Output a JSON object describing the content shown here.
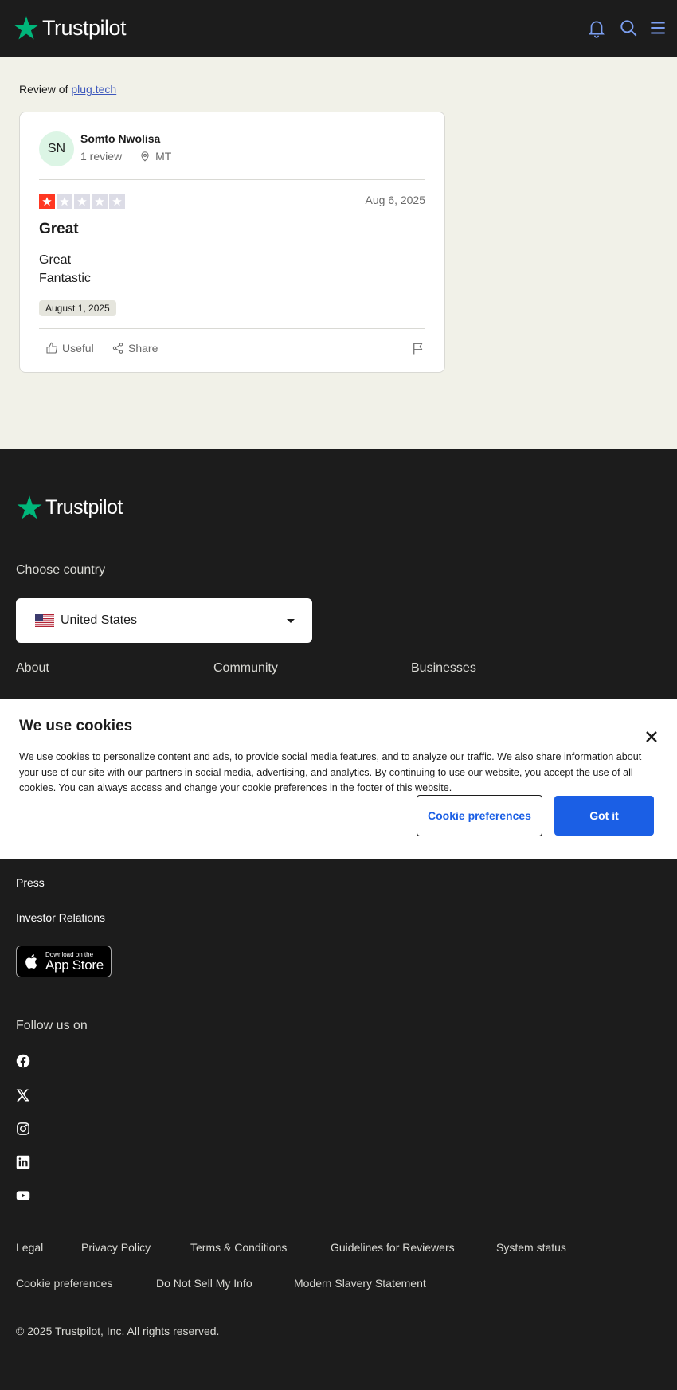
{
  "header": {
    "brand": "Trustpilot",
    "icons": [
      "bell-icon",
      "search-icon",
      "menu-icon"
    ],
    "bg_color": "#1c1c1c",
    "accent": "#00b67a",
    "icon_color": "#7b9ef0"
  },
  "review": {
    "prefix": "Review of ",
    "company": "plug.tech",
    "reviewer": {
      "initials": "SN",
      "name": "Somto Nwolisa",
      "review_count": "1 review",
      "country": "MT"
    },
    "rating": 1,
    "rating_max": 5,
    "star_color": "#ff3722",
    "date": "Aug 6, 2025",
    "title": "Great",
    "body_lines": [
      "Great",
      "Fantastic"
    ],
    "experience_date": "August 1, 2025",
    "actions": {
      "useful": "Useful",
      "share": "Share"
    }
  },
  "footer": {
    "brand": "Trustpilot",
    "choose_country": "Choose country",
    "country": "United States",
    "columns": [
      "About",
      "Community",
      "Businesses"
    ],
    "links": [
      "Press",
      "Investor Relations"
    ],
    "app_store": {
      "small": "Download on the",
      "big": "App Store"
    },
    "follow": "Follow us on",
    "social": [
      "facebook-icon",
      "x-icon",
      "instagram-icon",
      "linkedin-icon",
      "youtube-icon"
    ],
    "legal_row1": [
      "Legal",
      "Privacy Policy",
      "Terms & Conditions",
      "Guidelines for Reviewers",
      "System status"
    ],
    "legal_row2": [
      "Cookie preferences",
      "Do Not Sell My Info",
      "Modern Slavery Statement"
    ],
    "copyright": "© 2025 Trustpilot, Inc. All rights reserved."
  },
  "cookie_banner": {
    "title": "We use cookies",
    "text": "We use cookies to personalize content and ads, to provide social media features, and to analyze our traffic. We also share information about your use of our site with our partners in social media, advertising, and analytics. By continuing to use our website, you accept the use of all cookies. You can always access and change your cookie preferences in the footer of this website.",
    "preferences_button": "Cookie preferences",
    "accept_button": "Got it",
    "button_color": "#1b5fe5"
  }
}
